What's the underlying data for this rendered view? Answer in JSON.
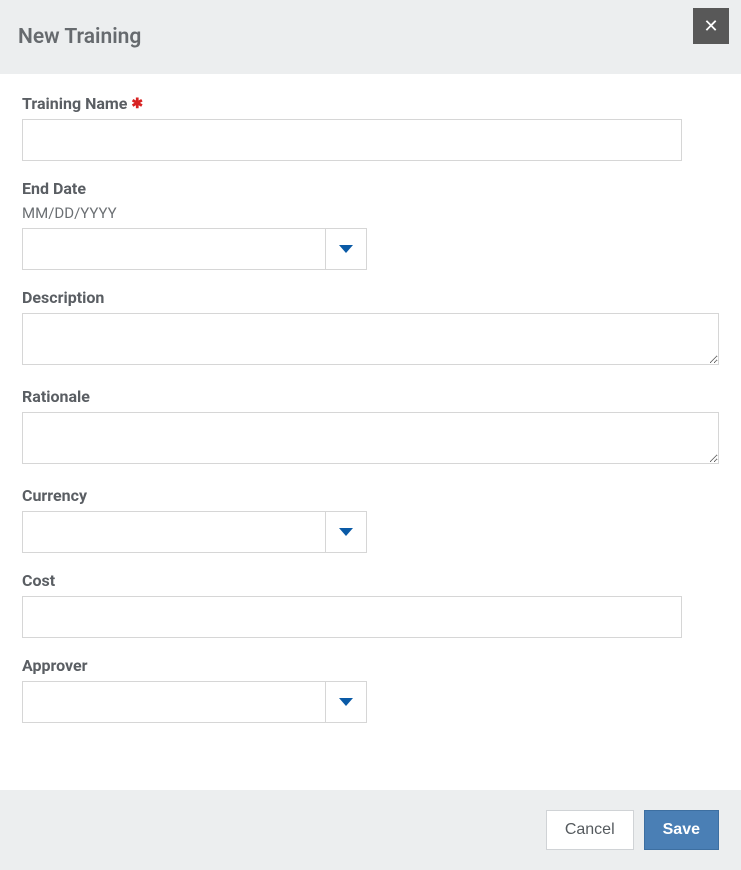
{
  "header": {
    "title": "New Training",
    "close_glyph": "✕"
  },
  "form": {
    "training_name": {
      "label": "Training Name",
      "required_mark": "✱",
      "value": ""
    },
    "end_date": {
      "label": "End Date",
      "format_hint": "MM/DD/YYYY",
      "value": ""
    },
    "description": {
      "label": "Description",
      "value": ""
    },
    "rationale": {
      "label": "Rationale",
      "value": ""
    },
    "currency": {
      "label": "Currency",
      "value": ""
    },
    "cost": {
      "label": "Cost",
      "value": ""
    },
    "approver": {
      "label": "Approver",
      "value": ""
    }
  },
  "footer": {
    "cancel_label": "Cancel",
    "save_label": "Save"
  }
}
